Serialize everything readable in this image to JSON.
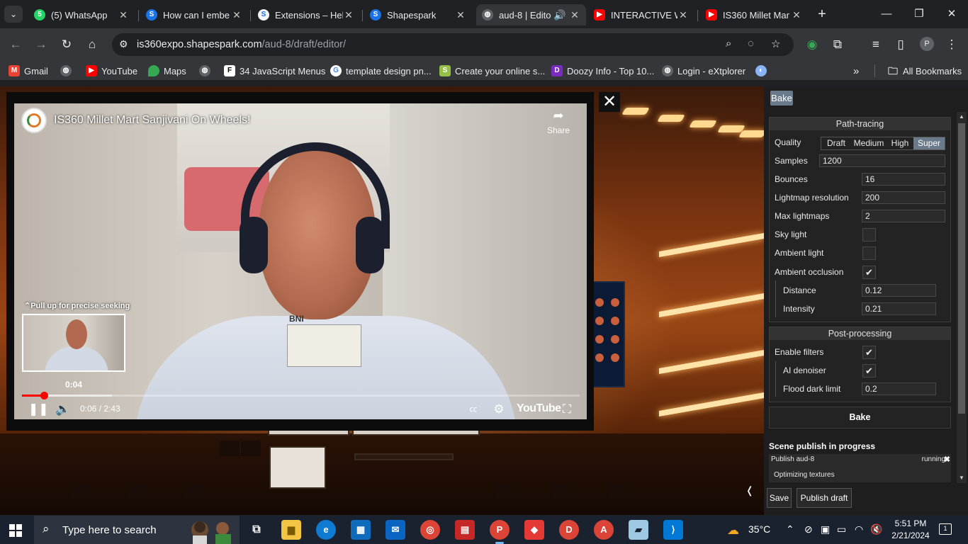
{
  "browser": {
    "tabs": [
      {
        "title": "(5) WhatsApp",
        "favicon": "whatsapp-icon",
        "color": "#25d366",
        "badge": "5"
      },
      {
        "title": "How can I embe",
        "favicon": "shapespark-icon",
        "color": "#1a73e8"
      },
      {
        "title": "Extensions – Hel",
        "favicon": "shapespark-s-icon",
        "color": "#f1f3f4"
      },
      {
        "title": "Shapespark",
        "favicon": "shapespark-icon",
        "color": "#1a73e8"
      },
      {
        "title": "aud-8 | Edito",
        "favicon": "globe-icon",
        "color": "#9aa0a6",
        "active": true
      },
      {
        "title": "INTERACTIVE W",
        "favicon": "youtube-icon",
        "color": "#ff0000"
      },
      {
        "title": "IS360 Millet Mar",
        "favicon": "youtube-icon",
        "color": "#ff0000"
      }
    ],
    "url_host": "is360expo.shapespark.com",
    "url_path": "/aud-8/draft/editor/",
    "profile_initial": "P",
    "bookmarks": [
      {
        "label": "Gmail",
        "icon": "gmail-icon"
      },
      {
        "label": "",
        "icon": "globe-icon"
      },
      {
        "label": "YouTube",
        "icon": "youtube-icon"
      },
      {
        "label": "Maps",
        "icon": "maps-icon"
      },
      {
        "label": "",
        "icon": "globe-icon"
      },
      {
        "label": "34 JavaScript Menus",
        "icon": "f-icon"
      },
      {
        "label": "template design pn...",
        "icon": "google-icon"
      },
      {
        "label": "Create your online s...",
        "icon": "shopify-icon"
      },
      {
        "label": "Doozy Info - Top 10...",
        "icon": "doozy-icon"
      },
      {
        "label": "Login - eXtplorer",
        "icon": "globe-icon"
      },
      {
        "label": "",
        "icon": "extension-icon"
      }
    ],
    "all_bookmarks": "All Bookmarks"
  },
  "video": {
    "title": "IS360 Millet Mart Sanjivani On Wheels!",
    "share": "Share",
    "seek_hint": "Pull up for precise seeking",
    "thumb_time": "0:04",
    "time_display": "0:06 / 2:43",
    "played_fraction": 0.04,
    "youtube_logo": "YouTube",
    "badge_text": "BNI"
  },
  "panel": {
    "bake_tab": "Bake",
    "path_tracing": {
      "heading": "Path-tracing",
      "quality_label": "Quality",
      "quality_options": [
        "Draft",
        "Medium",
        "High",
        "Super"
      ],
      "quality_selected": "Super",
      "samples_label": "Samples",
      "samples": "1200",
      "bounces_label": "Bounces",
      "bounces": "16",
      "lightmap_res_label": "Lightmap resolution",
      "lightmap_res": "200",
      "max_lightmaps_label": "Max lightmaps",
      "max_lightmaps": "2",
      "sky_light_label": "Sky light",
      "sky_light": false,
      "ambient_light_label": "Ambient light",
      "ambient_light": false,
      "ambient_occlusion_label": "Ambient occlusion",
      "ambient_occlusion": true,
      "distance_label": "Distance",
      "distance": "0.12",
      "intensity_label": "Intensity",
      "intensity": "0.21"
    },
    "post_processing": {
      "heading": "Post-processing",
      "enable_filters_label": "Enable filters",
      "enable_filters": true,
      "ai_denoiser_label": "AI denoiser",
      "ai_denoiser": true,
      "flood_dark_label": "Flood dark limit",
      "flood_dark": "0.2"
    },
    "bake_button": "Bake",
    "publish": {
      "title": "Scene publish in progress",
      "name": "Publish aud-8",
      "status": "running",
      "message": "Optimizing textures"
    },
    "save_button": "Save",
    "publish_draft_button": "Publish draft"
  },
  "taskbar": {
    "search_placeholder": "Type here to search",
    "temperature": "35°C",
    "time": "5:51 PM",
    "date": "2/21/2024",
    "notification_count": "1"
  }
}
